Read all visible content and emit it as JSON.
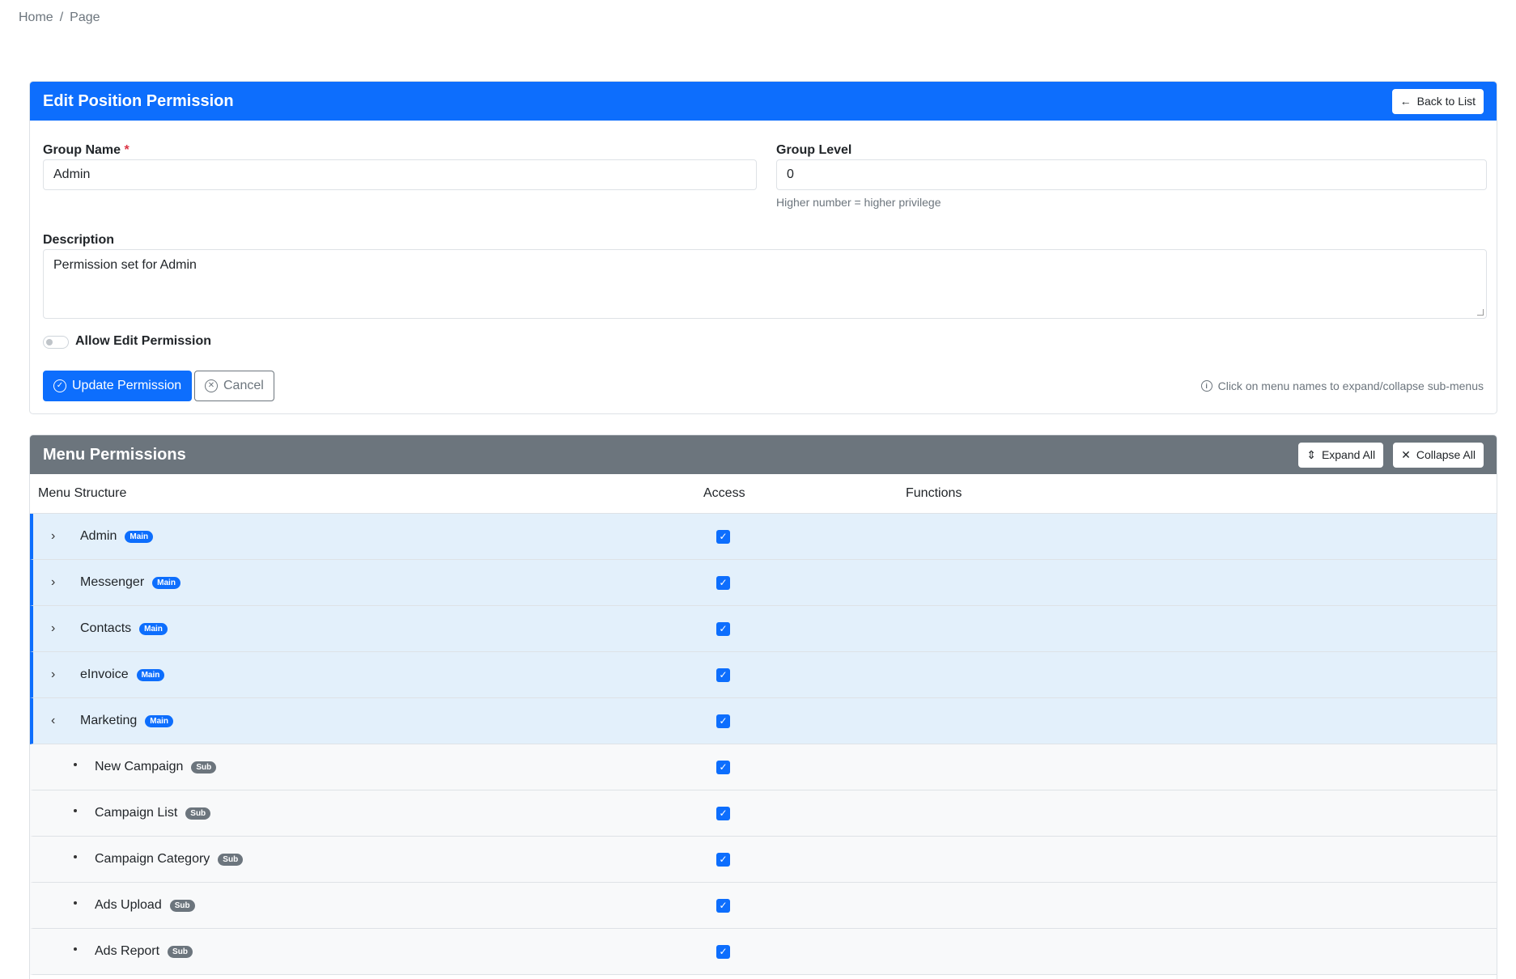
{
  "breadcrumb": {
    "home": "Home",
    "separator": "/",
    "current": "Page"
  },
  "edit_card": {
    "title": "Edit Position Permission",
    "back_label": "Back to List",
    "group_name_label": "Group Name",
    "required_mark": "*",
    "group_name_value": "Admin",
    "group_level_label": "Group Level",
    "group_level_value": "0",
    "group_level_help": "Higher number = higher privilege",
    "description_label": "Description",
    "description_value": "Permission set for Admin",
    "allow_edit_label": "Allow Edit Permission",
    "allow_edit_enabled": false,
    "update_label": "Update Permission",
    "cancel_label": "Cancel",
    "hint": "Click on menu names to expand/collapse sub-menus"
  },
  "permissions_card": {
    "title": "Menu Permissions",
    "expand_all_label": "Expand All",
    "collapse_all_label": "Collapse All",
    "columns": {
      "menu": "Menu Structure",
      "access": "Access",
      "functions": "Functions"
    },
    "rows": [
      {
        "label": "Admin",
        "badge": "Main",
        "type": "main",
        "expanded": false,
        "access": true
      },
      {
        "label": "Messenger",
        "badge": "Main",
        "type": "main",
        "expanded": false,
        "access": true
      },
      {
        "label": "Contacts",
        "badge": "Main",
        "type": "main",
        "expanded": false,
        "access": true
      },
      {
        "label": "eInvoice",
        "badge": "Main",
        "type": "main",
        "expanded": false,
        "access": true
      },
      {
        "label": "Marketing",
        "badge": "Main",
        "type": "main",
        "expanded": true,
        "access": true
      },
      {
        "label": "New Campaign",
        "badge": "Sub",
        "type": "sub",
        "access": true
      },
      {
        "label": "Campaign List",
        "badge": "Sub",
        "type": "sub",
        "access": true
      },
      {
        "label": "Campaign Category",
        "badge": "Sub",
        "type": "sub",
        "access": true
      },
      {
        "label": "Ads Upload",
        "badge": "Sub",
        "type": "sub",
        "access": true
      },
      {
        "label": "Ads Report",
        "badge": "Sub",
        "type": "sub",
        "access": true
      }
    ]
  },
  "colors": {
    "primary": "#0d6efd",
    "secondary": "#6c757d",
    "main_row_bg": "#e3f0fb"
  }
}
